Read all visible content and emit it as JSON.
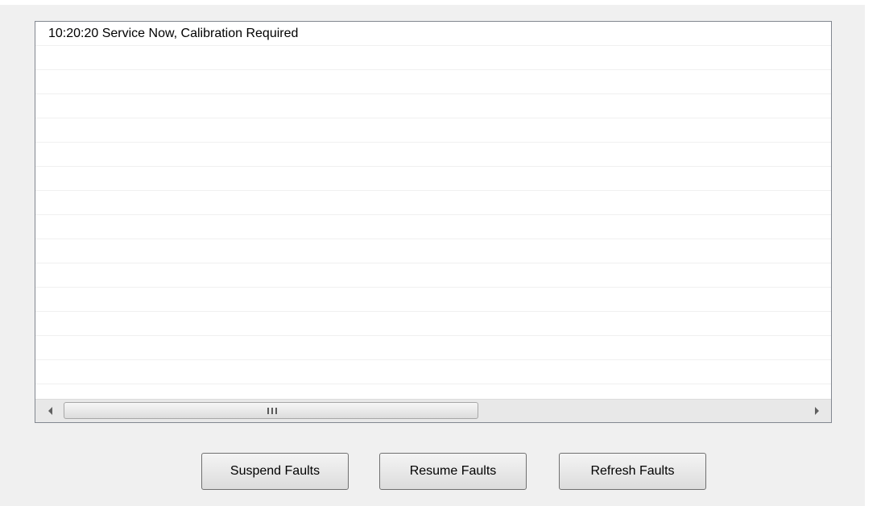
{
  "fault_log": {
    "rows": [
      "10:20:20 Service Now, Calibration Required",
      "",
      "",
      "",
      "",
      "",
      "",
      "",
      "",
      "",
      "",
      "",
      "",
      "",
      "",
      ""
    ]
  },
  "scrollbar": {
    "left_arrow_icon": "left-triangle-icon",
    "right_arrow_icon": "right-triangle-icon",
    "grip_icon": "three-bar-grip-icon"
  },
  "buttons": {
    "suspend_label": "Suspend Faults",
    "resume_label": "Resume Faults",
    "refresh_label": "Refresh Faults"
  },
  "colors": {
    "panel_background": "#f0f0f0",
    "list_background": "#ffffff",
    "list_border": "#828790",
    "row_separator": "#f0f0f0"
  }
}
